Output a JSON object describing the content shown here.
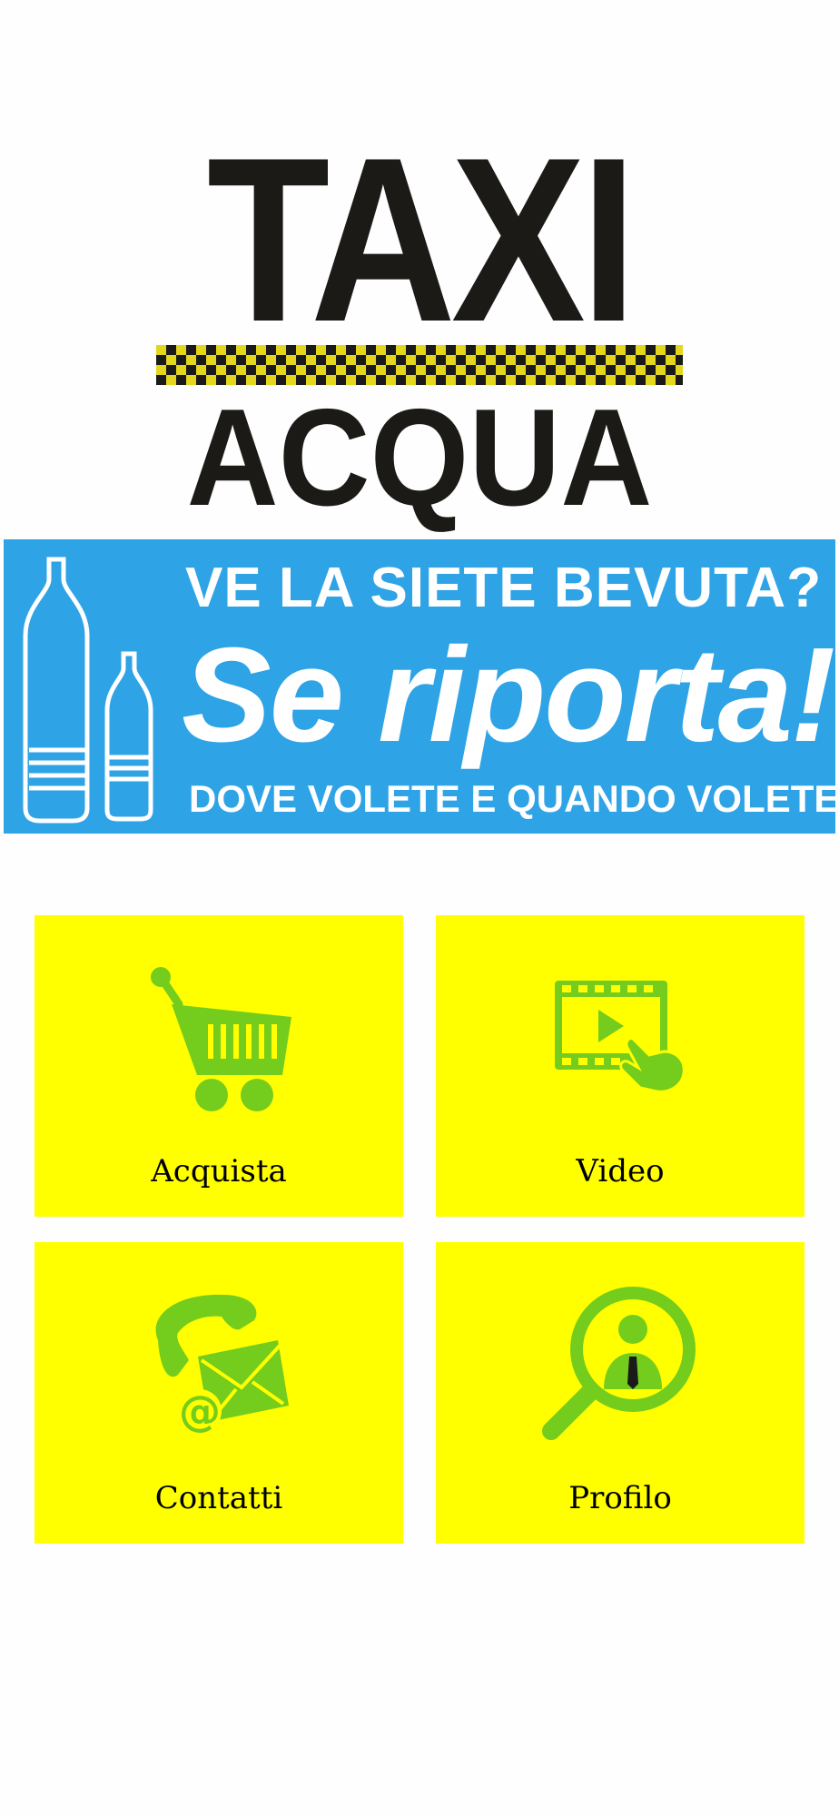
{
  "logo": {
    "line1": "TAXI",
    "line2": "ACQUA"
  },
  "banner": {
    "line1": "VE LA SIETE BEVUTA?",
    "line2": "Se riporta!",
    "line3": "DOVE VOLETE E QUANDO VOLETE",
    "bg_color": "#2ea3e6"
  },
  "menu": {
    "tile_color": "#ffff00",
    "icon_color": "#74cc1c",
    "items": [
      {
        "label": "Acquista",
        "icon": "shopping-cart-icon"
      },
      {
        "label": "Video",
        "icon": "video-play-icon"
      },
      {
        "label": "Contatti",
        "icon": "phone-mail-icon"
      },
      {
        "label": "Profilo",
        "icon": "profile-search-icon"
      }
    ]
  }
}
